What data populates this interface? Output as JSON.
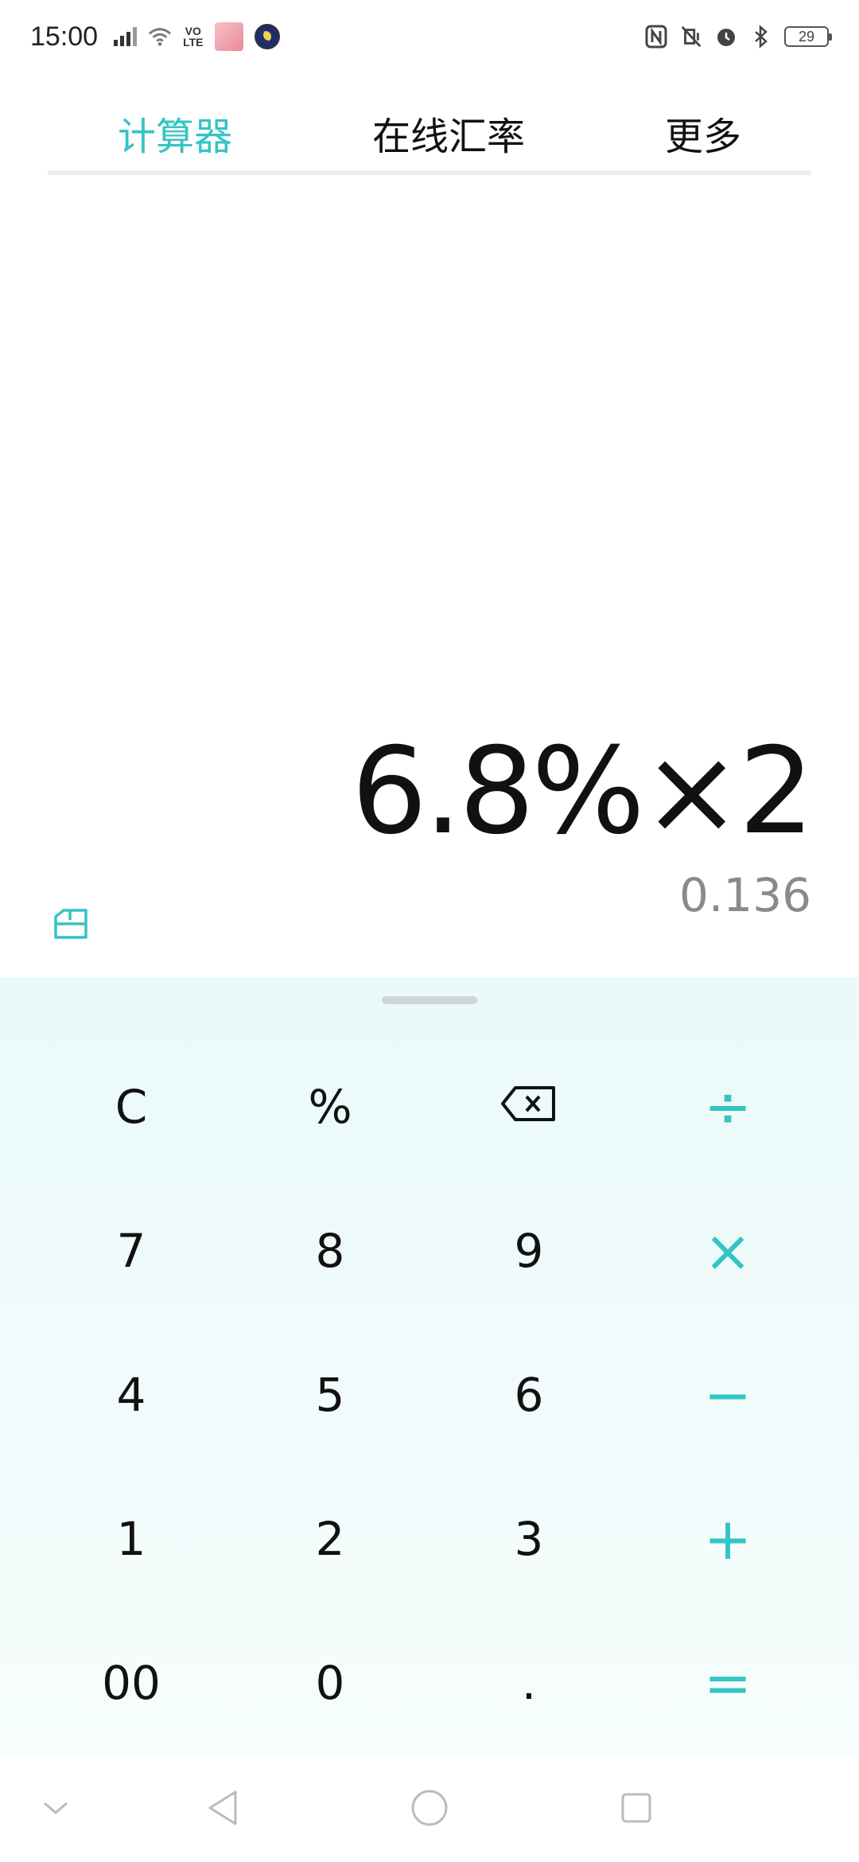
{
  "status_bar": {
    "time": "15:00",
    "volte_line1": "VO",
    "volte_line2": "LTE",
    "battery": "29"
  },
  "tabs": [
    {
      "label": "计算器",
      "active": true
    },
    {
      "label": "在线汇率",
      "active": false
    },
    {
      "label": "更多",
      "active": false
    }
  ],
  "display": {
    "expression": "6.8%×2",
    "result": "0.136"
  },
  "keypad": {
    "rows": [
      [
        "C",
        "%",
        "",
        "÷"
      ],
      [
        "7",
        "8",
        "9",
        "×"
      ],
      [
        "4",
        "5",
        "6",
        "−"
      ],
      [
        "1",
        "2",
        "3",
        "+"
      ],
      [
        "00",
        "0",
        ".",
        "="
      ]
    ]
  },
  "colors": {
    "accent": "#34c4c4",
    "keypad_bg": "#eaf9f9",
    "result_gray": "#8a8a8a"
  },
  "icons": {
    "history": "history-icon",
    "backspace": "backspace-icon"
  }
}
